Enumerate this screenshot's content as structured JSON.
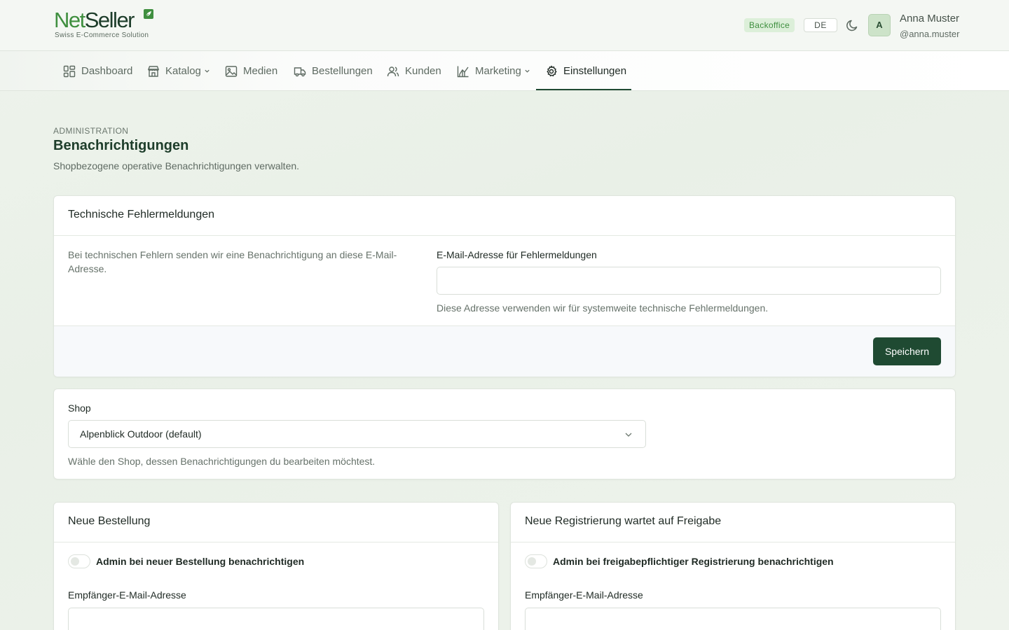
{
  "brand": {
    "name_part1": "Net",
    "name_part2": "Seller",
    "tagline": "Swiss E-Commerce Solution"
  },
  "header": {
    "badge": "Backoffice",
    "language": "DE",
    "user": {
      "initial": "A",
      "name": "Anna Muster",
      "handle": "@anna.muster"
    }
  },
  "nav": {
    "items": [
      {
        "label": "Dashboard",
        "icon": "dashboard-icon"
      },
      {
        "label": "Katalog",
        "icon": "store-icon",
        "has_dropdown": true
      },
      {
        "label": "Medien",
        "icon": "image-icon"
      },
      {
        "label": "Bestellungen",
        "icon": "truck-icon"
      },
      {
        "label": "Kunden",
        "icon": "users-icon"
      },
      {
        "label": "Marketing",
        "icon": "chart-icon",
        "has_dropdown": true
      },
      {
        "label": "Einstellungen",
        "icon": "gear-icon",
        "active": true
      }
    ]
  },
  "page": {
    "breadcrumb": "ADMINISTRATION",
    "title": "Benachrichtigungen",
    "subtitle": "Shopbezogene operative Benachrichtigungen verwalten."
  },
  "error_card": {
    "title": "Technische Fehlermeldungen",
    "description": "Bei technischen Fehlern senden wir eine Benachrichtigung an diese E-Mail-Adresse.",
    "field_label": "E-Mail-Adresse für Fehlermeldungen",
    "field_value": "",
    "field_hint": "Diese Adresse verwenden wir für systemweite technische Fehlermeldungen.",
    "save_label": "Speichern"
  },
  "shop_card": {
    "label": "Shop",
    "selected": "Alpenblick Outdoor (default)",
    "hint": "Wähle den Shop, dessen Benachrichtigungen du bearbeiten möchtest."
  },
  "order_card": {
    "title": "Neue Bestellung",
    "toggle_label": "Admin bei neuer Bestellung benachrichtigen",
    "toggle_on": false,
    "recipient_label": "Empfänger-E-Mail-Adresse",
    "recipient_value": ""
  },
  "registration_card": {
    "title": "Neue Registrierung wartet auf Freigabe",
    "toggle_label": "Admin bei freigabepflichtiger Registrierung benachrichtigen",
    "toggle_on": false,
    "recipient_label": "Empfänger-E-Mail-Adresse",
    "recipient_value": ""
  },
  "colors": {
    "brand_dark": "#1f4a32",
    "brand_green": "#3f8f3f",
    "badge_bg": "#dcefd9"
  }
}
